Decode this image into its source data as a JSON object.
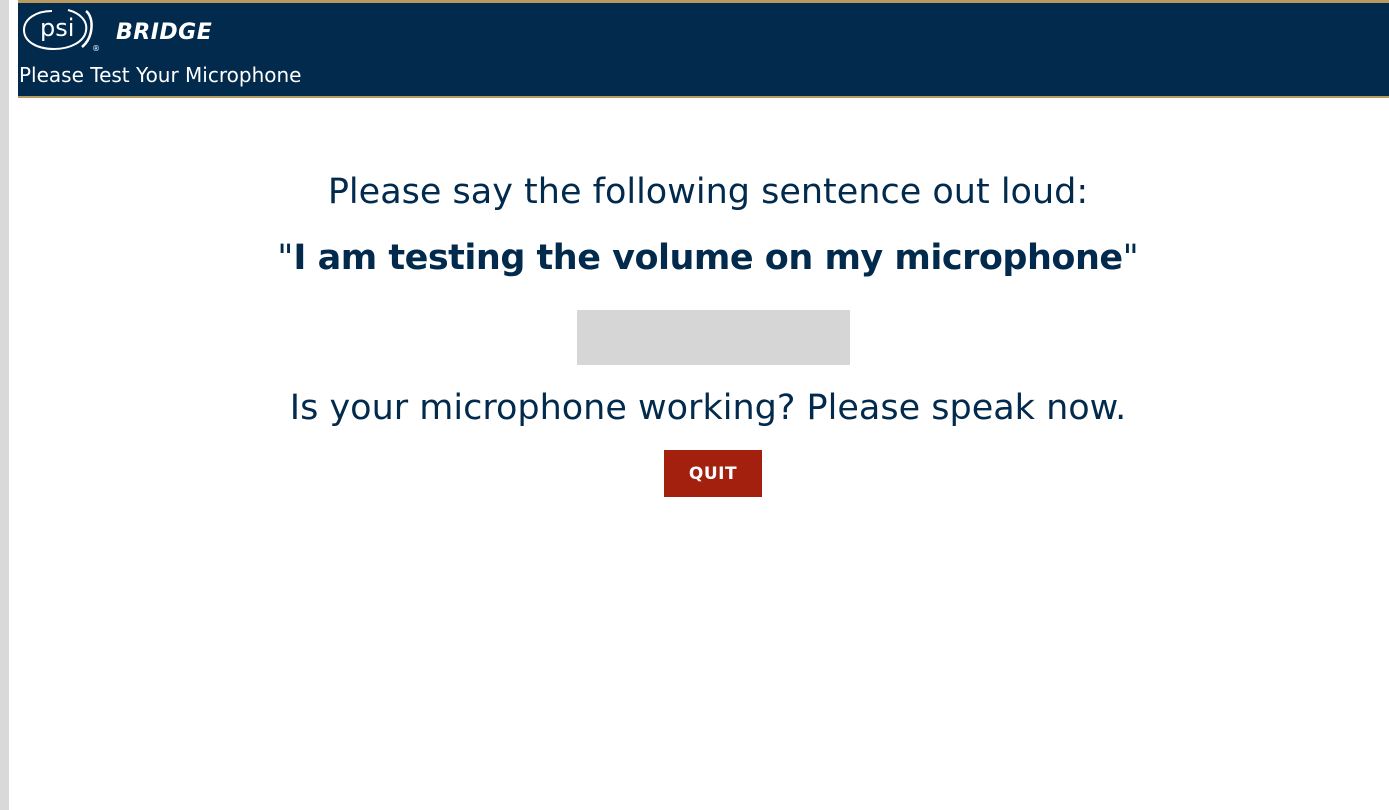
{
  "header": {
    "logo_psi": "psi",
    "logo_registered": "®",
    "logo_product": "BRIDGE",
    "title": "Please Test Your Microphone"
  },
  "main": {
    "instruction": "Please say the following sentence out loud:",
    "sentence_open_quote": "\"",
    "sentence": "I am testing the volume on my microphone",
    "sentence_close_quote": "\"",
    "volume_level_percent": 0,
    "question": "Is your microphone working? Please speak now.",
    "quit_label": "QUIT"
  },
  "colors": {
    "header_bg": "#022a4d",
    "header_border": "#b99a5f",
    "text": "#022a4d",
    "quit_bg": "#a3200f",
    "meter_bg": "#d6d6d6"
  }
}
